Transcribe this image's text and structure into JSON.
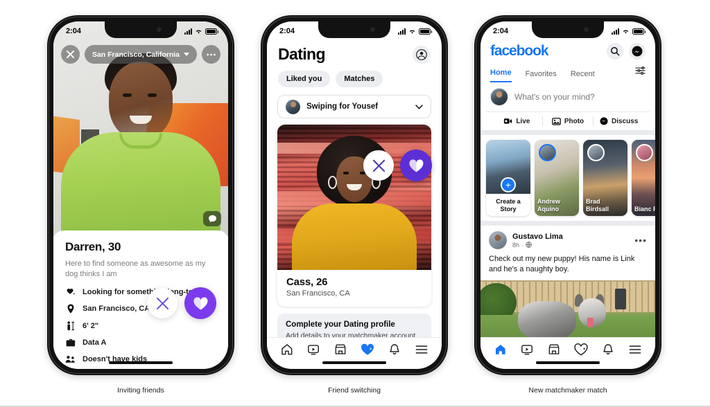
{
  "status_bar": {
    "time": "2:04",
    "icons": [
      "signal-bars",
      "wifi",
      "battery"
    ]
  },
  "phone1": {
    "caption": "Inviting friends",
    "topbar": {
      "close_icon": "close-icon",
      "location": "San Francisco, California",
      "more_icon": "more-horizontal-icon"
    },
    "chat_icon": "chat-bubble-icon",
    "profile": {
      "name_age": "Darren, 30",
      "bio": "Here to find someone as awesome as my dog thinks I am",
      "attributes": [
        {
          "icon": "relationship-icon",
          "label": "Looking for something long-term"
        },
        {
          "icon": "location-pin-icon",
          "label": "San Francisco, CA"
        },
        {
          "icon": "height-icon",
          "label": "6' 2\""
        },
        {
          "icon": "briefcase-icon",
          "label": "Data A"
        },
        {
          "icon": "family-icon",
          "label": "Doesn't have kids"
        }
      ]
    },
    "actions": {
      "pass_icon": "close-icon",
      "like_icon": "heart-icon"
    },
    "accent_purple": "#7c3aed"
  },
  "phone2": {
    "caption": "Friend switching",
    "header": {
      "title": "Dating",
      "profile_icon": "account-circle-icon"
    },
    "chips": [
      "Liked you",
      "Matches"
    ],
    "swiping_for": {
      "label": "Swiping for Yousef",
      "chevron": "chevron-down-icon"
    },
    "match_card": {
      "name_age": "Cass, 26",
      "location": "San Francisco, CA",
      "pass_icon": "close-icon",
      "like_icon": "heart-icon"
    },
    "promo": {
      "title": "Complete your Dating profile",
      "subtitle": "Add details to your matchmaker account to start finding matches for yourself."
    },
    "tabbar": [
      {
        "icon": "home-icon",
        "active": false
      },
      {
        "icon": "video-icon",
        "active": false
      },
      {
        "icon": "marketplace-icon",
        "active": false
      },
      {
        "icon": "dating-heart-icon",
        "active": true
      },
      {
        "icon": "bell-icon",
        "active": false
      },
      {
        "icon": "menu-icon",
        "active": false
      }
    ],
    "accent_blue": "#1877f2",
    "accent_purple": "#7c3aed"
  },
  "phone3": {
    "caption": "New matchmaker match",
    "header": {
      "logo": "facebook",
      "search_icon": "search-icon",
      "messenger_icon": "messenger-icon"
    },
    "tabs": [
      {
        "label": "Home",
        "active": true
      },
      {
        "label": "Favorites",
        "active": false
      },
      {
        "label": "Recent",
        "active": false
      }
    ],
    "filters_icon": "sliders-icon",
    "composer": {
      "placeholder": "What's on your mind?",
      "avatar": "user-avatar"
    },
    "quick_actions": [
      {
        "icon": "live-icon",
        "label": "Live"
      },
      {
        "icon": "photo-icon",
        "label": "Photo"
      },
      {
        "icon": "discuss-icon",
        "label": "Discuss"
      }
    ],
    "stories": [
      {
        "name": "Create a Story",
        "type": "create",
        "plus_icon": "plus-icon"
      },
      {
        "name": "Andrew Aquino",
        "type": "story"
      },
      {
        "name": "Brad Birdsall",
        "type": "story"
      },
      {
        "name": "Bianc Romu",
        "type": "story"
      }
    ],
    "post": {
      "author": "Gustavo Lima",
      "time": "8h",
      "privacy_icon": "globe-icon",
      "more_icon": "more-horizontal-icon",
      "text": "Check out my new puppy! His name is Link and he's a naughty boy.",
      "image_alt": "puppy-photo"
    },
    "tabbar": [
      {
        "icon": "home-icon",
        "active": true
      },
      {
        "icon": "video-icon",
        "active": false
      },
      {
        "icon": "marketplace-icon",
        "active": false
      },
      {
        "icon": "dating-heart-icon",
        "active": false
      },
      {
        "icon": "bell-icon",
        "active": false
      },
      {
        "icon": "menu-icon",
        "active": false
      }
    ],
    "accent_blue": "#1877f2"
  }
}
